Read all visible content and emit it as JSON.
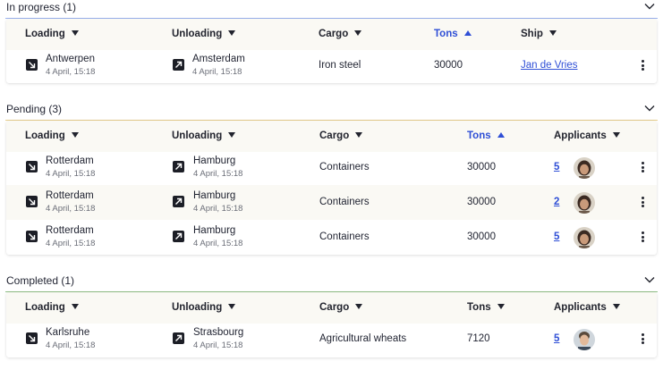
{
  "sections": {
    "in_progress": {
      "title": "In progress (1)",
      "accent": "#9db4f0",
      "headers": {
        "loading": "Loading",
        "unloading": "Unloading",
        "cargo": "Cargo",
        "tons": "Tons",
        "ship": "Ship"
      },
      "rows": [
        {
          "loading_city": "Antwerpen",
          "loading_date": "4 April, 15:18",
          "unloading_city": "Amsterdam",
          "unloading_date": "4 April, 15:18",
          "cargo": "Iron steel",
          "tons": "30000",
          "ship": "Jan de Vries"
        }
      ]
    },
    "pending": {
      "title": "Pending (3)",
      "accent": "#e8cf8e",
      "headers": {
        "loading": "Loading",
        "unloading": "Unloading",
        "cargo": "Cargo",
        "tons": "Tons",
        "applicants": "Applicants"
      },
      "rows": [
        {
          "loading_city": "Rotterdam",
          "loading_date": "4 April, 15:18",
          "unloading_city": "Hamburg",
          "unloading_date": "4 April, 15:18",
          "cargo": "Containers",
          "tons": "30000",
          "applicants": "5"
        },
        {
          "loading_city": "Rotterdam",
          "loading_date": "4 April, 15:18",
          "unloading_city": "Hamburg",
          "unloading_date": "4 April, 15:18",
          "cargo": "Containers",
          "tons": "30000",
          "applicants": "2"
        },
        {
          "loading_city": "Rotterdam",
          "loading_date": "4 April, 15:18",
          "unloading_city": "Hamburg",
          "unloading_date": "4 April, 15:18",
          "cargo": "Containers",
          "tons": "30000",
          "applicants": "5"
        }
      ]
    },
    "completed": {
      "title": "Completed (1)",
      "accent": "#8fbf86",
      "headers": {
        "loading": "Loading",
        "unloading": "Unloading",
        "cargo": "Cargo",
        "tons": "Tons",
        "applicants": "Applicants"
      },
      "rows": [
        {
          "loading_city": "Karlsruhe",
          "loading_date": "4 April, 15:18",
          "unloading_city": "Strasbourg",
          "unloading_date": "4 April, 15:18",
          "cargo": "Agricultural wheats",
          "tons": "7120",
          "applicants": "5"
        }
      ]
    }
  },
  "icons": {
    "loading": "arrow-down-right-icon",
    "unloading": "arrow-up-right-icon",
    "collapse": "chevron-down-icon",
    "sort": "caret-icon",
    "more": "more-vertical-icon",
    "avatar": "applicant-avatar"
  },
  "colors": {
    "link": "#2f4fd6",
    "header_bg": "#faf9f4",
    "icon_bg": "#1c1e26"
  }
}
